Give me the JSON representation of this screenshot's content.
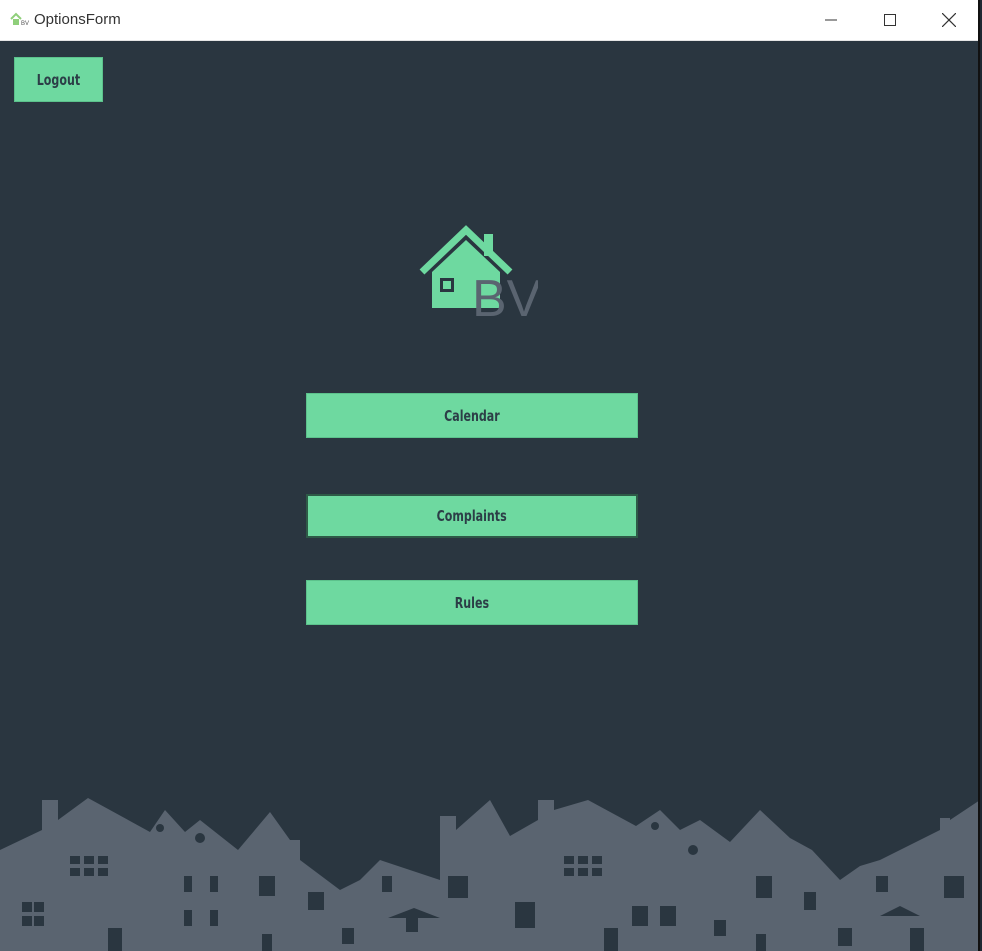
{
  "window": {
    "title": "OptionsForm",
    "app_icon": "house-bv-icon",
    "controls": {
      "minimize": "minimize-icon",
      "maximize": "maximize-icon",
      "close": "close-icon"
    }
  },
  "toolbar": {
    "logout_label": "Logout"
  },
  "logo": {
    "icon": "house-icon",
    "text": "BV"
  },
  "menu": {
    "calendar_label": "Calendar",
    "complaints_label": "Complaints",
    "rules_label": "Rules"
  },
  "colors": {
    "background": "#2a3640",
    "accent": "#6ed9a0",
    "button_text": "#2c3e47",
    "skyline": "#5a6470"
  }
}
